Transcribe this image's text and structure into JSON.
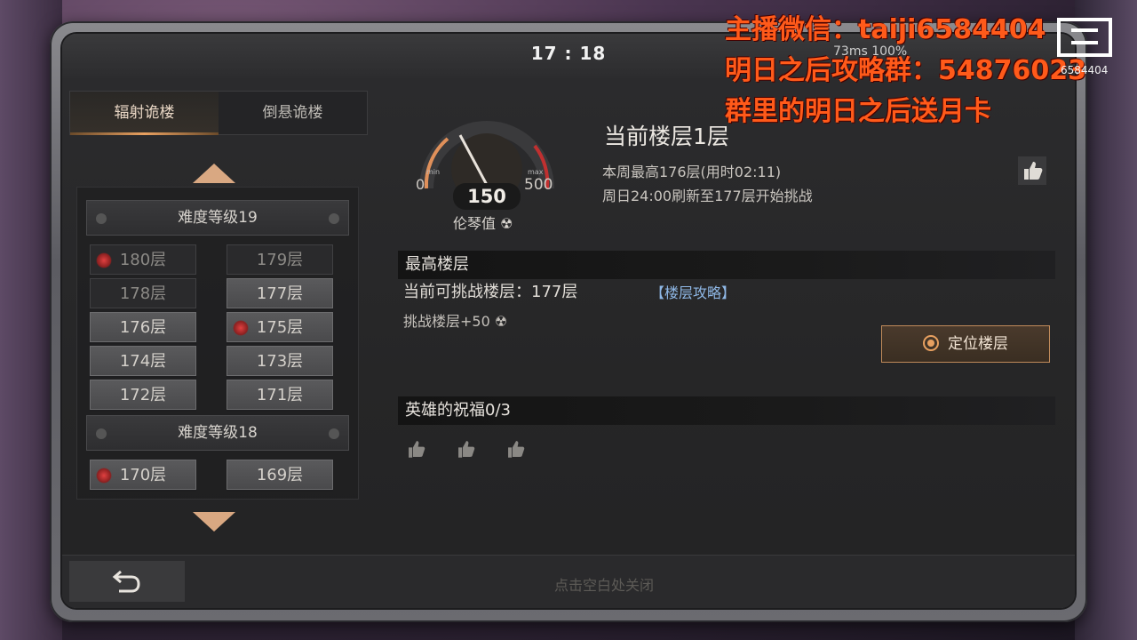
{
  "status": {
    "time": "17 : 18",
    "extra": "73ms 100%"
  },
  "tabs": [
    {
      "label": "辐射诡楼",
      "active": true
    },
    {
      "label": "倒悬诡楼",
      "active": false
    }
  ],
  "floors": {
    "groups": [
      {
        "title": "难度等级19",
        "floors": [
          {
            "label": "180层",
            "state": "marked-locked"
          },
          {
            "label": "179层",
            "state": "locked"
          },
          {
            "label": "178层",
            "state": "locked"
          },
          {
            "label": "177层",
            "state": "unlocked"
          },
          {
            "label": "176层",
            "state": "unlocked"
          },
          {
            "label": "175层",
            "state": "marked"
          },
          {
            "label": "174层",
            "state": "unlocked"
          },
          {
            "label": "173层",
            "state": "unlocked"
          },
          {
            "label": "172层",
            "state": "unlocked"
          },
          {
            "label": "171层",
            "state": "unlocked"
          }
        ]
      },
      {
        "title": "难度等级18",
        "floors": [
          {
            "label": "170层",
            "state": "marked"
          },
          {
            "label": "169层",
            "state": "unlocked"
          }
        ]
      }
    ]
  },
  "gauge": {
    "min_label": "min",
    "max_label": "max",
    "min": "0",
    "max": "500",
    "value": "150",
    "label": "伦琴值 ☢"
  },
  "info": {
    "current_floor": "当前楼层1层",
    "week_best": "本周最高176层(用时02:11)",
    "refresh": "周日24:00刷新至177层开始挑战"
  },
  "highest": {
    "title": "最高楼层",
    "challenge_floor": "当前可挑战楼层：177层",
    "guide_link": "【楼层攻略】",
    "bonus": "挑战楼层+50 ☢",
    "locate_button": "定位楼层"
  },
  "blessing": {
    "title": "英雄的祝福0/3",
    "count": 3
  },
  "bottom": {
    "close_hint": "点击空白处关闭"
  },
  "overlay": {
    "line1": "主播微信：taiji6584404",
    "line2": "明日之后攻略群：54876023",
    "line3": "群里的明日之后送月卡",
    "logo_id": "6584404"
  },
  "colors": {
    "accent": "#e8a060",
    "overlay": "#ff5a1a",
    "link": "#8fb8e6"
  }
}
